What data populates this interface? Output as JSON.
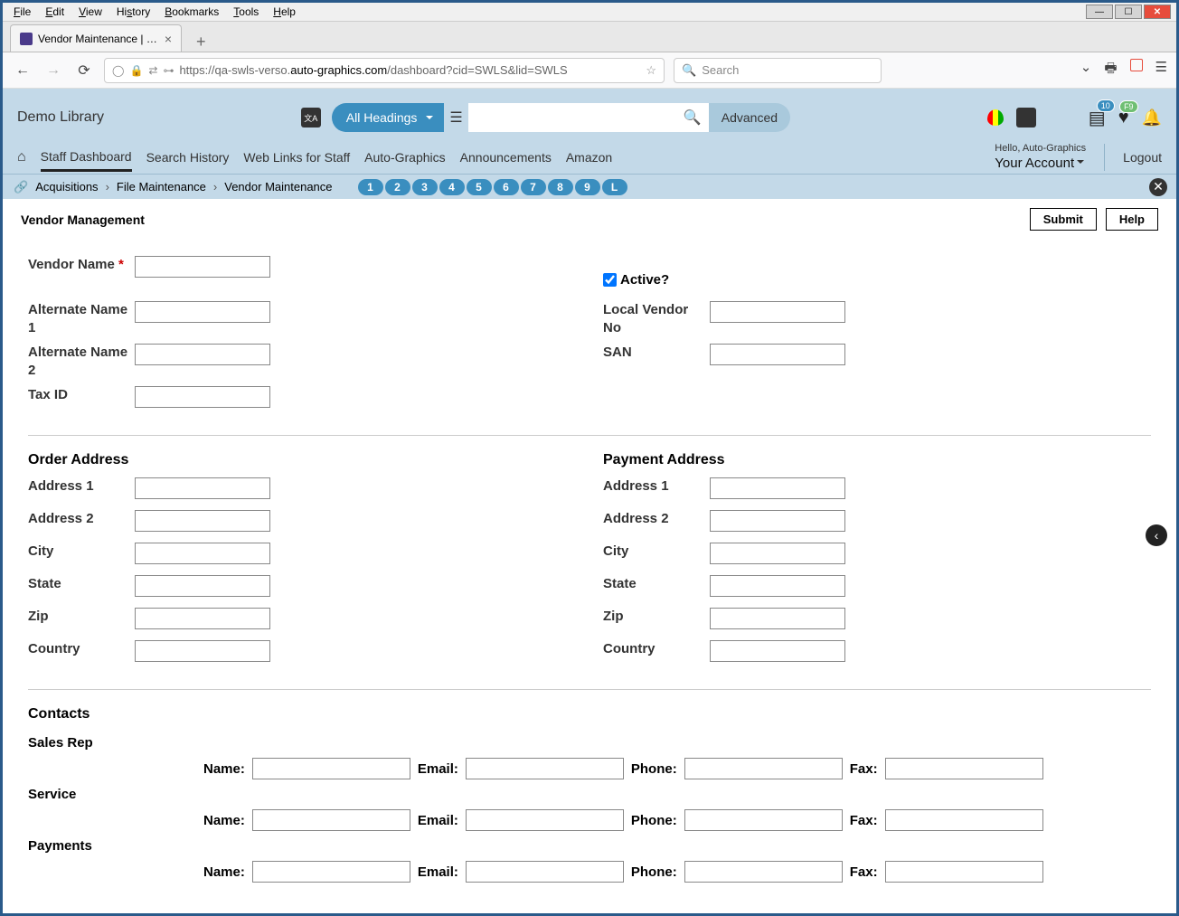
{
  "window": {
    "menus": [
      "File",
      "Edit",
      "View",
      "History",
      "Bookmarks",
      "Tools",
      "Help"
    ],
    "tab_title": "Vendor Maintenance | SWLS | sv",
    "url_display": "https://qa-swls-verso.auto-graphics.com/dashboard?cid=SWLS&lid=SWLS",
    "url_host": "auto-graphics.com",
    "search_placeholder": "Search"
  },
  "header": {
    "library": "Demo Library",
    "headings": "All Headings",
    "advanced": "Advanced",
    "list_badge": "10",
    "heart_badge": "F9",
    "hello": "Hello, Auto-Graphics",
    "account": "Your Account",
    "logout": "Logout",
    "nav": [
      "Staff Dashboard",
      "Search History",
      "Web Links for Staff",
      "Auto-Graphics",
      "Announcements",
      "Amazon"
    ]
  },
  "breadcrumb": {
    "parts": [
      "Acquisitions",
      "File Maintenance",
      "Vendor Maintenance"
    ],
    "pills": [
      "1",
      "2",
      "3",
      "4",
      "5",
      "6",
      "7",
      "8",
      "9",
      "L"
    ]
  },
  "page": {
    "title": "Vendor Management",
    "submit": "Submit",
    "help": "Help"
  },
  "form": {
    "vendor_name_label": "Vendor Name",
    "vendor_name": "",
    "active_label": "Active?",
    "active": true,
    "alt1_label": "Alternate Name 1",
    "alt1": "",
    "local_vendor_label": "Local Vendor No",
    "local_vendor": "",
    "alt2_label": "Alternate Name 2",
    "alt2": "",
    "san_label": "SAN",
    "san": "",
    "taxid_label": "Tax ID",
    "taxid": "",
    "order_title": "Order Address",
    "payment_title": "Payment Address",
    "addr1_label": "Address 1",
    "addr2_label": "Address 2",
    "city_label": "City",
    "state_label": "State",
    "zip_label": "Zip",
    "country_label": "Country",
    "contacts_title": "Contacts",
    "contacts": {
      "roles": [
        "Sales Rep",
        "Service",
        "Payments"
      ],
      "fields": {
        "name": "Name:",
        "email": "Email:",
        "phone": "Phone:",
        "fax": "Fax:"
      }
    }
  }
}
